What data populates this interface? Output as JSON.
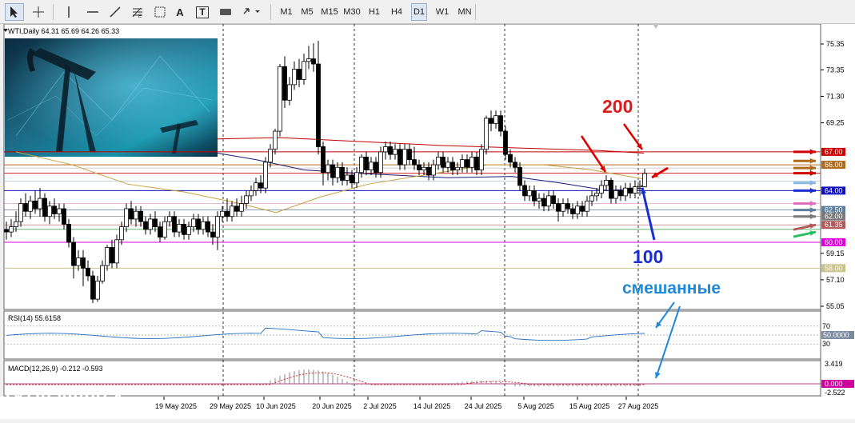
{
  "toolbar": {
    "timeframes": [
      "M1",
      "M5",
      "M15",
      "M30",
      "H1",
      "H4",
      "D1",
      "W1",
      "MN"
    ],
    "active_timeframe": "D1",
    "text_tool": "A",
    "label_tool": "T"
  },
  "chart": {
    "symbol_line": "WTI,Daily  64.31 65.69 64.26 65.33",
    "price_ticks": [
      "75.35",
      "73.35",
      "71.30",
      "69.25",
      "67.00",
      "66.00",
      "64.00",
      "62.50",
      "62.00",
      "61.35",
      "60.00",
      "59.15",
      "58.00",
      "57.10",
      "55.05"
    ],
    "date_ticks": [
      "19 May 2025",
      "29 May 2025",
      "10 Jun 2025",
      "20 Jun 2025",
      "2 Jul 2025",
      "14 Jul 2025",
      "24 Jul 2025",
      "5 Aug 2025",
      "15 Aug 2025",
      "27 Aug 2025"
    ],
    "level_labels": [
      {
        "text": "67.00",
        "color": "#d10000"
      },
      {
        "text": "66.00",
        "color": "#b06a1a"
      },
      {
        "text": "64.00",
        "color": "#1010c0"
      },
      {
        "text": "62.50",
        "color": "#5a7fa0"
      },
      {
        "text": "62.00",
        "color": "#7a7a7a"
      },
      {
        "text": "61.35",
        "color": "#b25a5a"
      },
      {
        "text": "60.00",
        "color": "#e000e0"
      },
      {
        "text": "58.00",
        "color": "#c9c38a"
      }
    ]
  },
  "annotations": {
    "ma200": "200",
    "ma100": "100",
    "mixed": "смешанные"
  },
  "rsi": {
    "title": "RSI(14) 55.6158",
    "ticks": [
      "70",
      "30"
    ],
    "current": "50.0000"
  },
  "macd": {
    "title": "MACD(12,26,9) -0.212 -0.593",
    "ticks": [
      "3.419",
      "-2.522"
    ],
    "current": "0.000"
  },
  "logo": {
    "name": "instaforex",
    "tagline": "Instant Forex Trading"
  },
  "colors": {
    "ma200": "#c00000",
    "ma100": "#1a1a7a",
    "ma50": "#c8a040",
    "red_arrow": "#dd0000",
    "blue_arrow": "#1a2fd0",
    "cyan_arrow": "#1e88d8"
  }
}
